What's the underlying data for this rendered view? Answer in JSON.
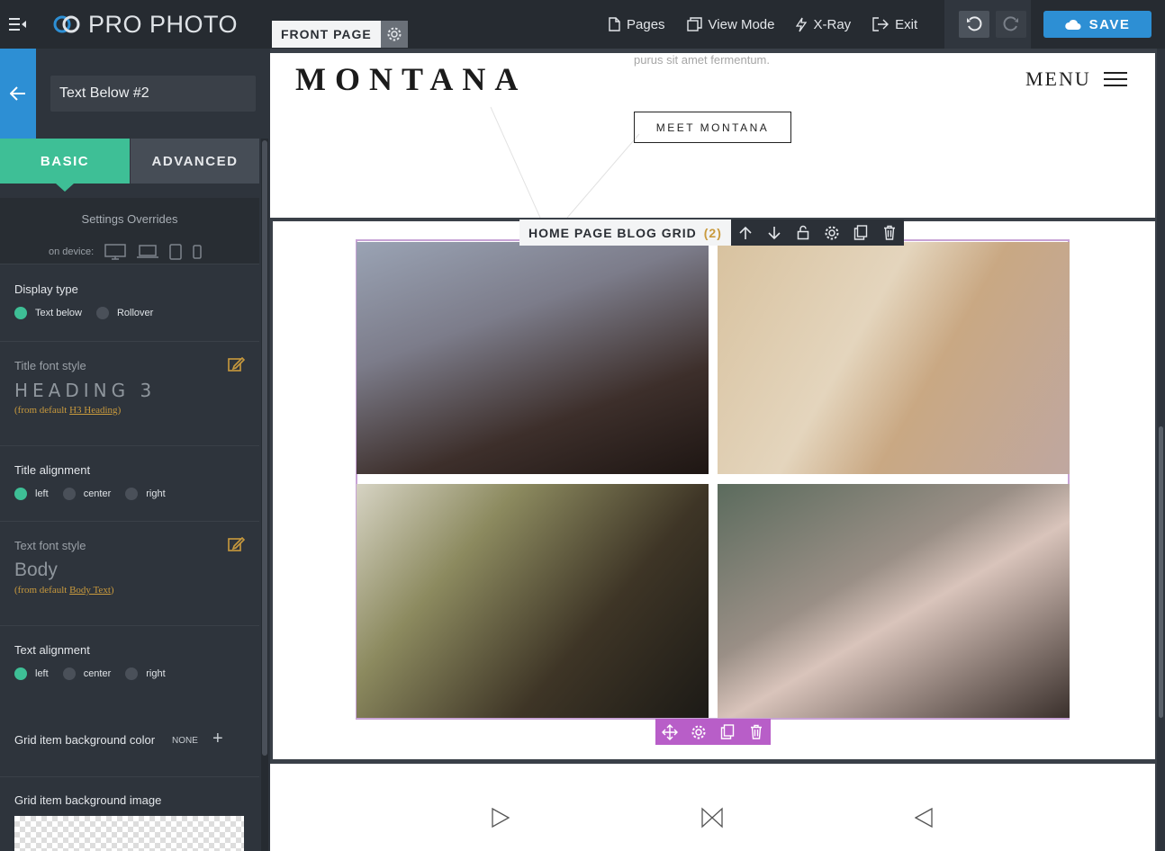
{
  "topbar": {
    "brand": "PRO PHOTO",
    "nav": [
      {
        "label": "Pages",
        "icon": "page-icon"
      },
      {
        "label": "View Mode",
        "icon": "view-mode-icon"
      },
      {
        "label": "X-Ray",
        "icon": "x-ray-icon"
      },
      {
        "label": "Exit",
        "icon": "exit-icon"
      }
    ],
    "save_label": "SAVE"
  },
  "canvas": {
    "front_page_label": "FRONT PAGE",
    "hero": {
      "brand_title": "MONTANA",
      "lorem": "purus sit amet fermentum.",
      "meet_button": "MEET MONTANA",
      "menu_label": "MENU"
    },
    "grid_block": {
      "label": "HOME PAGE BLOG GRID",
      "count": "(2)"
    }
  },
  "sidebar": {
    "title_value": "Text Below #2",
    "tabs": {
      "basic": "BASIC",
      "advanced": "ADVANCED"
    },
    "overrides": {
      "title": "Settings Overrides",
      "device_label": "on device:"
    },
    "display_type": {
      "label": "Display type",
      "options": [
        "Text below",
        "Rollover"
      ],
      "selected": "Text below"
    },
    "title_font": {
      "label": "Title font style",
      "preview": "HEADING 3",
      "from_prefix": "(from default ",
      "from_link": "H3 Heading",
      "from_suffix": ")"
    },
    "title_alignment": {
      "label": "Title alignment",
      "options": [
        "left",
        "center",
        "right"
      ],
      "selected": "left"
    },
    "text_font": {
      "label": "Text font style",
      "preview": "Body",
      "from_prefix": "(from default ",
      "from_link": "Body Text",
      "from_suffix": ")"
    },
    "text_alignment": {
      "label": "Text alignment",
      "options": [
        "left",
        "center",
        "right"
      ],
      "selected": "left"
    },
    "bg_color": {
      "label": "Grid item background color",
      "value": "NONE"
    },
    "bg_image": {
      "label": "Grid item background image"
    }
  },
  "colors": {
    "accent_green": "#3ebf96",
    "accent_blue": "#2d8fd4",
    "gold": "#c99a3d",
    "purple": "#b85ec8"
  }
}
